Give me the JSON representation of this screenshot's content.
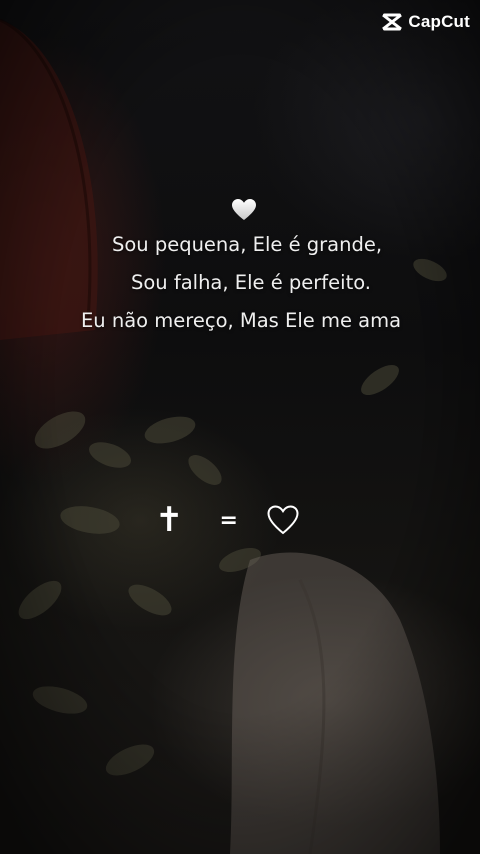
{
  "watermark": {
    "brand_label": "CapCut",
    "icon": "capcut-logo-icon"
  },
  "quote": {
    "heart_icon": "white-heart-emoji-icon",
    "lines": [
      "Sou pequena, Ele é grande,",
      "Sou falha, Ele é perfeito.",
      "Eu não mereço, Mas Ele me ama"
    ]
  },
  "symbols": {
    "cross": "✝",
    "equals": "=",
    "heart_icon": "outline-heart-icon"
  },
  "colors": {
    "text": "#efefef",
    "background": "#0f0f10",
    "accent_red": "#5a1e19"
  }
}
